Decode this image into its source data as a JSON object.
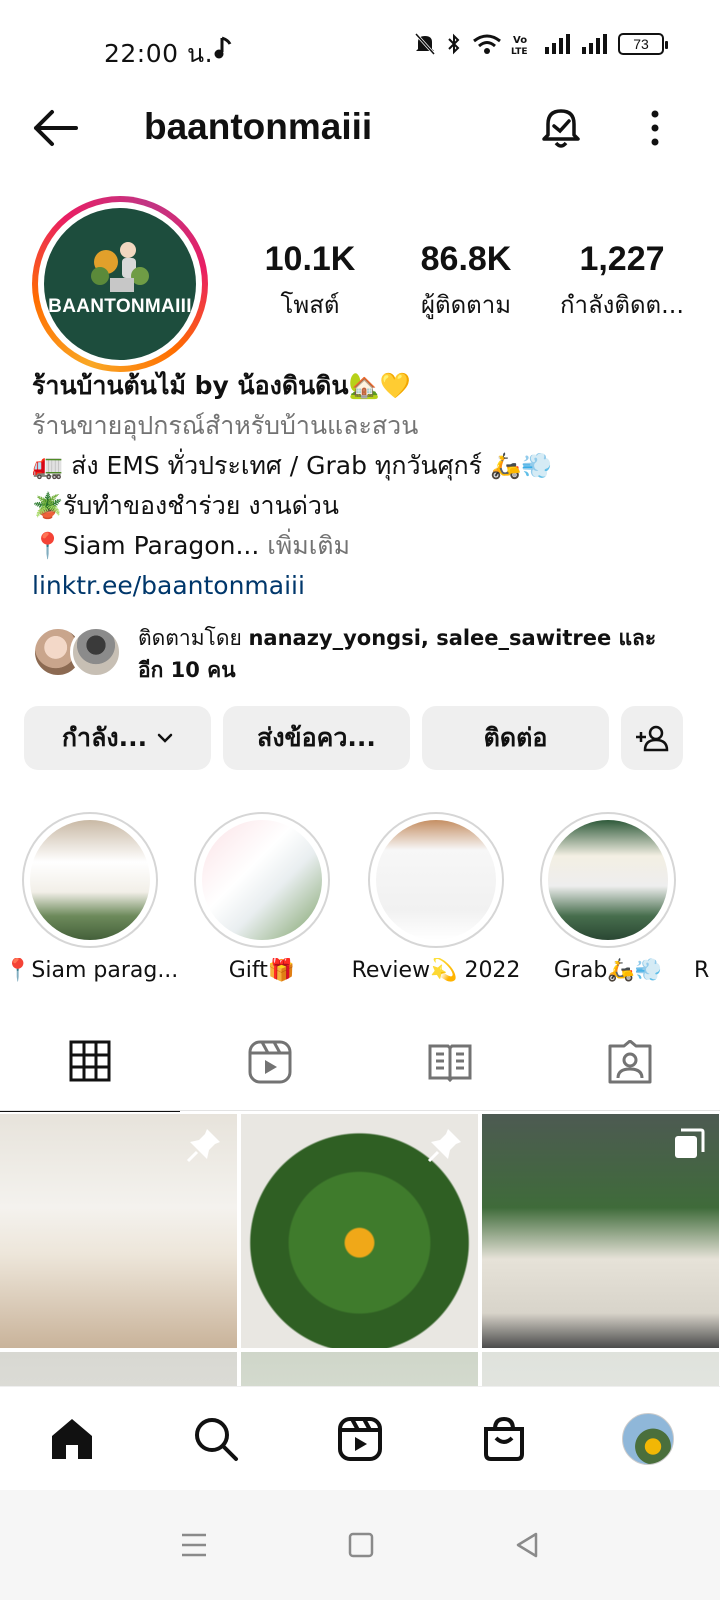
{
  "status_bar": {
    "time": "22:00 น.",
    "battery": "73"
  },
  "header": {
    "username": "baantonmaiii"
  },
  "profile": {
    "avatar_brand": "BAANTONMAIII",
    "stats": [
      {
        "value": "10.1K",
        "label": "โพสต์"
      },
      {
        "value": "86.8K",
        "label": "ผู้ติดตาม"
      },
      {
        "value": "1,227",
        "label": "กำลังติดต..."
      }
    ],
    "bio": {
      "name": "ร้านบ้านต้นไม้ by น้องดินดิน🏡💛",
      "category": "ร้านขายอุปกรณ์สำหรับบ้านและสวน",
      "line1": "🚛 ส่ง EMS ทั่วประเทศ / Grab ทุกวันศุกร์ 🛵💨",
      "line2": "🪴รับทำของชำร่วย งานด่วน",
      "line3": "📍Siam Paragon...",
      "more": " เพิ่มเติม",
      "link": "linktr.ee/baantonmaiii"
    },
    "followed_by": {
      "prefix": "ติดตามโดย ",
      "names": "nanazy_yongsi, salee_sawitree",
      "suffix": " และอีก 10 คน"
    }
  },
  "actions": {
    "following": "กำลัง...",
    "message": "ส่งข้อคว...",
    "contact": "ติดต่อ"
  },
  "highlights": [
    {
      "label": "📍Siam parag..."
    },
    {
      "label": "Gift🎁"
    },
    {
      "label": "Review💫 2022"
    },
    {
      "label": "Grab🛵💨"
    },
    {
      "label": "R"
    }
  ],
  "icons": {
    "back": "back-arrow-icon",
    "bell": "notification-bell-icon",
    "more": "more-vertical-icon",
    "grid": "grid-icon",
    "reels": "reels-icon",
    "guides": "guides-icon",
    "tagged": "tagged-icon",
    "home": "home-icon",
    "search": "search-icon",
    "shop": "shop-icon"
  },
  "colors": {
    "link": "#00376b",
    "secondary_text": "#737373",
    "button_bg": "#efefef"
  }
}
